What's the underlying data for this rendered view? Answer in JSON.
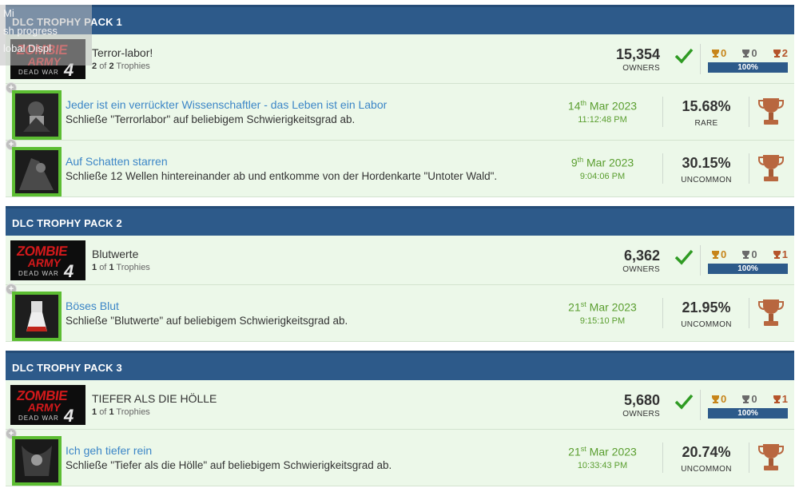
{
  "overlay": {
    "line1": "Mi",
    "line2": "sh progress",
    "line3": "lobal Displ"
  },
  "packs": [
    {
      "header": "DLC TROPHY PACK 1",
      "group": {
        "title": "Terror-labor!",
        "earned": "2",
        "of": "of",
        "total": "2",
        "trophies_label": "Trophies",
        "owners": "15,354",
        "owners_label": "OWNERS",
        "gold": "0",
        "silver": "0",
        "bronze": "2",
        "progress": "100%"
      },
      "trophies": [
        {
          "title": "Jeder ist ein verrückter Wissenschaftler - das Leben ist ein Labor",
          "desc": "Schließe \"Terrorlabor\" auf beliebigem Schwierigkeitsgrad ab.",
          "day": "14",
          "suffix": "th",
          "monthyear": "Mar 2023",
          "time": "11:12:48 PM",
          "percent": "15.68%",
          "rarity": "RARE"
        },
        {
          "title": "Auf Schatten starren",
          "desc": "Schließe 12 Wellen hintereinander ab und entkomme von der Hordenkarte \"Untoter Wald\".",
          "day": "9",
          "suffix": "th",
          "monthyear": "Mar 2023",
          "time": "9:04:06 PM",
          "percent": "30.15%",
          "rarity": "UNCOMMON"
        }
      ]
    },
    {
      "header": "DLC TROPHY PACK 2",
      "group": {
        "title": "Blutwerte",
        "earned": "1",
        "of": "of",
        "total": "1",
        "trophies_label": "Trophies",
        "owners": "6,362",
        "owners_label": "OWNERS",
        "gold": "0",
        "silver": "0",
        "bronze": "1",
        "progress": "100%"
      },
      "trophies": [
        {
          "title": "Böses Blut",
          "desc": "Schließe \"Blutwerte\" auf beliebigem Schwierigkeitsgrad ab.",
          "day": "21",
          "suffix": "st",
          "monthyear": "Mar 2023",
          "time": "9:15:10 PM",
          "percent": "21.95%",
          "rarity": "UNCOMMON"
        }
      ]
    },
    {
      "header": "DLC TROPHY PACK 3",
      "group": {
        "title": "TIEFER ALS DIE HÖLLE",
        "earned": "1",
        "of": "of",
        "total": "1",
        "trophies_label": "Trophies",
        "owners": "5,680",
        "owners_label": "OWNERS",
        "gold": "0",
        "silver": "0",
        "bronze": "1",
        "progress": "100%"
      },
      "trophies": [
        {
          "title": "Ich geh tiefer rein",
          "desc": "Schließe \"Tiefer als die Hölle\" auf beliebigem Schwierigkeitsgrad ab.",
          "day": "21",
          "suffix": "st",
          "monthyear": "Mar 2023",
          "time": "10:33:43 PM",
          "percent": "20.74%",
          "rarity": "UNCOMMON"
        }
      ]
    }
  ],
  "game_logo": {
    "line1": "ZOMBIE",
    "line2": "ARMY",
    "line3": "DEAD WAR",
    "line4": "4"
  },
  "colors": {
    "header": "#2d5a8a",
    "row_bg": "#ecf8e9",
    "accent_green": "#5cbd32",
    "link": "#3c86c7"
  },
  "icons": {
    "earned": "checkmark-icon",
    "trophy": "bronze-trophy-icon",
    "expand": "plus-icon"
  }
}
